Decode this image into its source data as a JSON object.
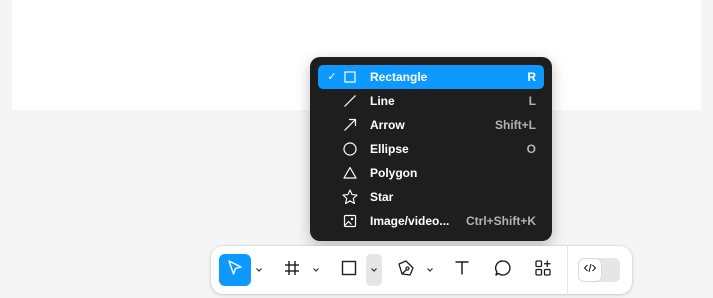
{
  "canvas": {
    "frame_color": "#ffffff",
    "background": "#f5f5f5"
  },
  "shape_menu": {
    "items": [
      {
        "label": "Rectangle",
        "shortcut": "R",
        "icon": "rectangle-icon",
        "checked": true
      },
      {
        "label": "Line",
        "shortcut": "L",
        "icon": "line-icon",
        "checked": false
      },
      {
        "label": "Arrow",
        "shortcut": "Shift+L",
        "icon": "arrow-icon",
        "checked": false
      },
      {
        "label": "Ellipse",
        "shortcut": "O",
        "icon": "ellipse-icon",
        "checked": false
      },
      {
        "label": "Polygon",
        "shortcut": "",
        "icon": "polygon-icon",
        "checked": false
      },
      {
        "label": "Star",
        "shortcut": "",
        "icon": "star-icon",
        "checked": false
      },
      {
        "label": "Image/video...",
        "shortcut": "Ctrl+Shift+K",
        "icon": "image-icon",
        "checked": false
      }
    ],
    "check_glyph": "✓"
  },
  "toolbar": {
    "tools": [
      {
        "name": "move-tool",
        "icon": "cursor-icon",
        "selected": true,
        "has_caret": true
      },
      {
        "name": "frame-tool",
        "icon": "frame-icon",
        "selected": false,
        "has_caret": true
      },
      {
        "name": "shape-tool",
        "icon": "rectangle-icon",
        "selected": false,
        "has_caret": true,
        "caret_open": true
      },
      {
        "name": "pen-tool",
        "icon": "pen-icon",
        "selected": false,
        "has_caret": true
      },
      {
        "name": "text-tool",
        "icon": "text-icon",
        "selected": false,
        "has_caret": false
      },
      {
        "name": "comment-tool",
        "icon": "comment-icon",
        "selected": false,
        "has_caret": false
      },
      {
        "name": "actions-tool",
        "icon": "shapes-plus-icon",
        "selected": false,
        "has_caret": false
      }
    ],
    "dev_mode": {
      "icon": "code-icon",
      "enabled": false
    }
  },
  "colors": {
    "accent": "#0d99ff",
    "menu_bg": "#1e1e1e",
    "shortcut_text": "#b3b3b3"
  }
}
